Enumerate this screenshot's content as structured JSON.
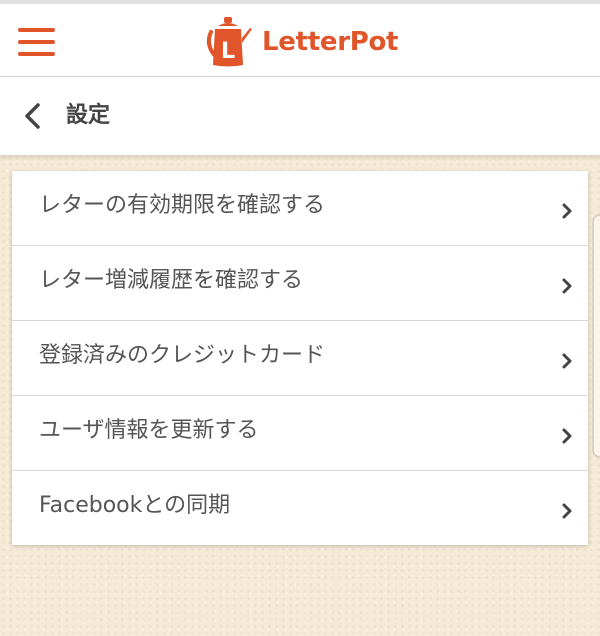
{
  "app": {
    "brand_name": "LetterPot",
    "logo_letter": "L",
    "accent_color": "#e0552a"
  },
  "header": {
    "menu_icon": "hamburger-menu-icon"
  },
  "subheader": {
    "back_icon": "chevron-left-icon",
    "title": "設定"
  },
  "menu": {
    "items": [
      {
        "label": "レターの有効期限を確認する",
        "icon": "chevron-right-icon"
      },
      {
        "label": "レター増減履歴を確認する",
        "icon": "chevron-right-icon"
      },
      {
        "label": "登録済みのクレジットカード",
        "icon": "chevron-right-icon"
      },
      {
        "label": "ユーザ情報を更新する",
        "icon": "chevron-right-icon"
      },
      {
        "label": "Facebookとの同期",
        "icon": "chevron-right-icon"
      }
    ]
  }
}
